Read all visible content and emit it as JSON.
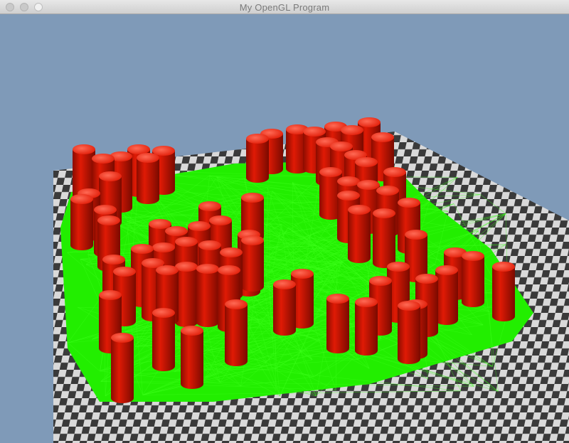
{
  "window": {
    "title": "My OpenGL Program"
  },
  "scene": {
    "background_color": "#7f9ab8",
    "floor_colors": [
      "#3a3a3a",
      "#d9d9d9"
    ],
    "plane_color": "#22ee00",
    "edge_color": "#3cff1a",
    "obstacle_color": "#e01a05",
    "obstacle_highlight": "#ff6a55",
    "obstacle_shape": "cylinder",
    "floor_pattern": "checkerboard"
  }
}
